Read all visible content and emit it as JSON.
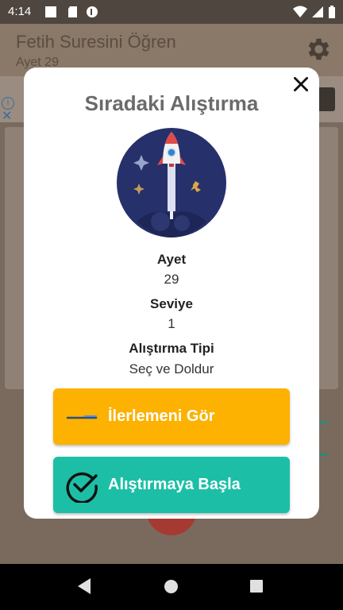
{
  "status": {
    "time": "4:14"
  },
  "app": {
    "title": "Fetih Suresini Öğren",
    "subtitle": "Ayet 29"
  },
  "dialog": {
    "title": "Sıradaki Alıştırma",
    "fields": [
      {
        "label": "Ayet",
        "value": "29"
      },
      {
        "label": "Seviye",
        "value": "1"
      },
      {
        "label": "Alıştırma Tipi",
        "value": "Seç ve Doldur"
      }
    ],
    "progress_button": "İlerlemeni Gör",
    "start_button": "Alıştırmaya Başla",
    "icons": [
      "close-icon",
      "rocket-icon",
      "progress-line-icon",
      "checkmark-circle-icon"
    ]
  },
  "colors": {
    "progress_button": "#fdb100",
    "start_button": "#1cbfa6",
    "rocket_bg": "#26306b"
  }
}
